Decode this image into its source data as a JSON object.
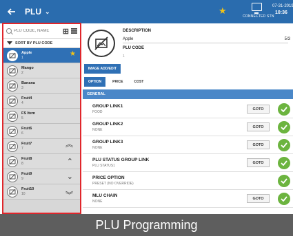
{
  "topbar": {
    "title": "PLU",
    "connection_label": "CONNECTED STN",
    "date": "07-31-2019",
    "time": "10:36"
  },
  "sidebar": {
    "search_placeholder": "PLU CODE, NAME",
    "sort_label": "SORT BY PLU CODE",
    "items": [
      {
        "name": "Apple",
        "code": "1"
      },
      {
        "name": "Mango",
        "code": "2"
      },
      {
        "name": "Banana",
        "code": "3"
      },
      {
        "name": "Fruit4",
        "code": "4"
      },
      {
        "name": "FS Item",
        "code": "5"
      },
      {
        "name": "Fruit6",
        "code": "6"
      },
      {
        "name": "Fruit7",
        "code": "7"
      },
      {
        "name": "Fruit8",
        "code": "8"
      },
      {
        "name": "Fruit9",
        "code": "9"
      },
      {
        "name": "Fruit10",
        "code": "10"
      }
    ]
  },
  "plu": {
    "description_label": "DESCRIPTION",
    "description_value": "Apple",
    "description_count": "5/3",
    "code_label": "PLU CODE",
    "code_value": "1",
    "image_button": "IMAGE ADD/EDIT"
  },
  "tabs": [
    "OPTION",
    "PRICE",
    "COST"
  ],
  "section_header": "GENERAL",
  "options": [
    {
      "label": "GROUP LINK1",
      "value": "FOOD",
      "goto": "GOTO"
    },
    {
      "label": "GROUP LINK2",
      "value": "NONE",
      "goto": "GOTO"
    },
    {
      "label": "GROUP LINK3",
      "value": "NONE",
      "goto": "GOTO"
    },
    {
      "label": "PLU STATUS GROUP LINK",
      "value": "PLU STATUS1",
      "goto": "GOTO"
    },
    {
      "label": "PRICE OPTION",
      "value": "PRESET (NO OVERRIDE)",
      "goto": ""
    },
    {
      "label": "MLU CHAIN",
      "value": "NONE",
      "goto": "GOTO"
    }
  ],
  "caption": "PLU Programming",
  "colors": {
    "header_blue": "#2a6cae",
    "selected_blue": "#2f70b5",
    "section_blue": "#4a87c8",
    "check_green": "#6cb43f",
    "highlight_red": "#e0262b",
    "star_yellow": "#f3c316"
  }
}
